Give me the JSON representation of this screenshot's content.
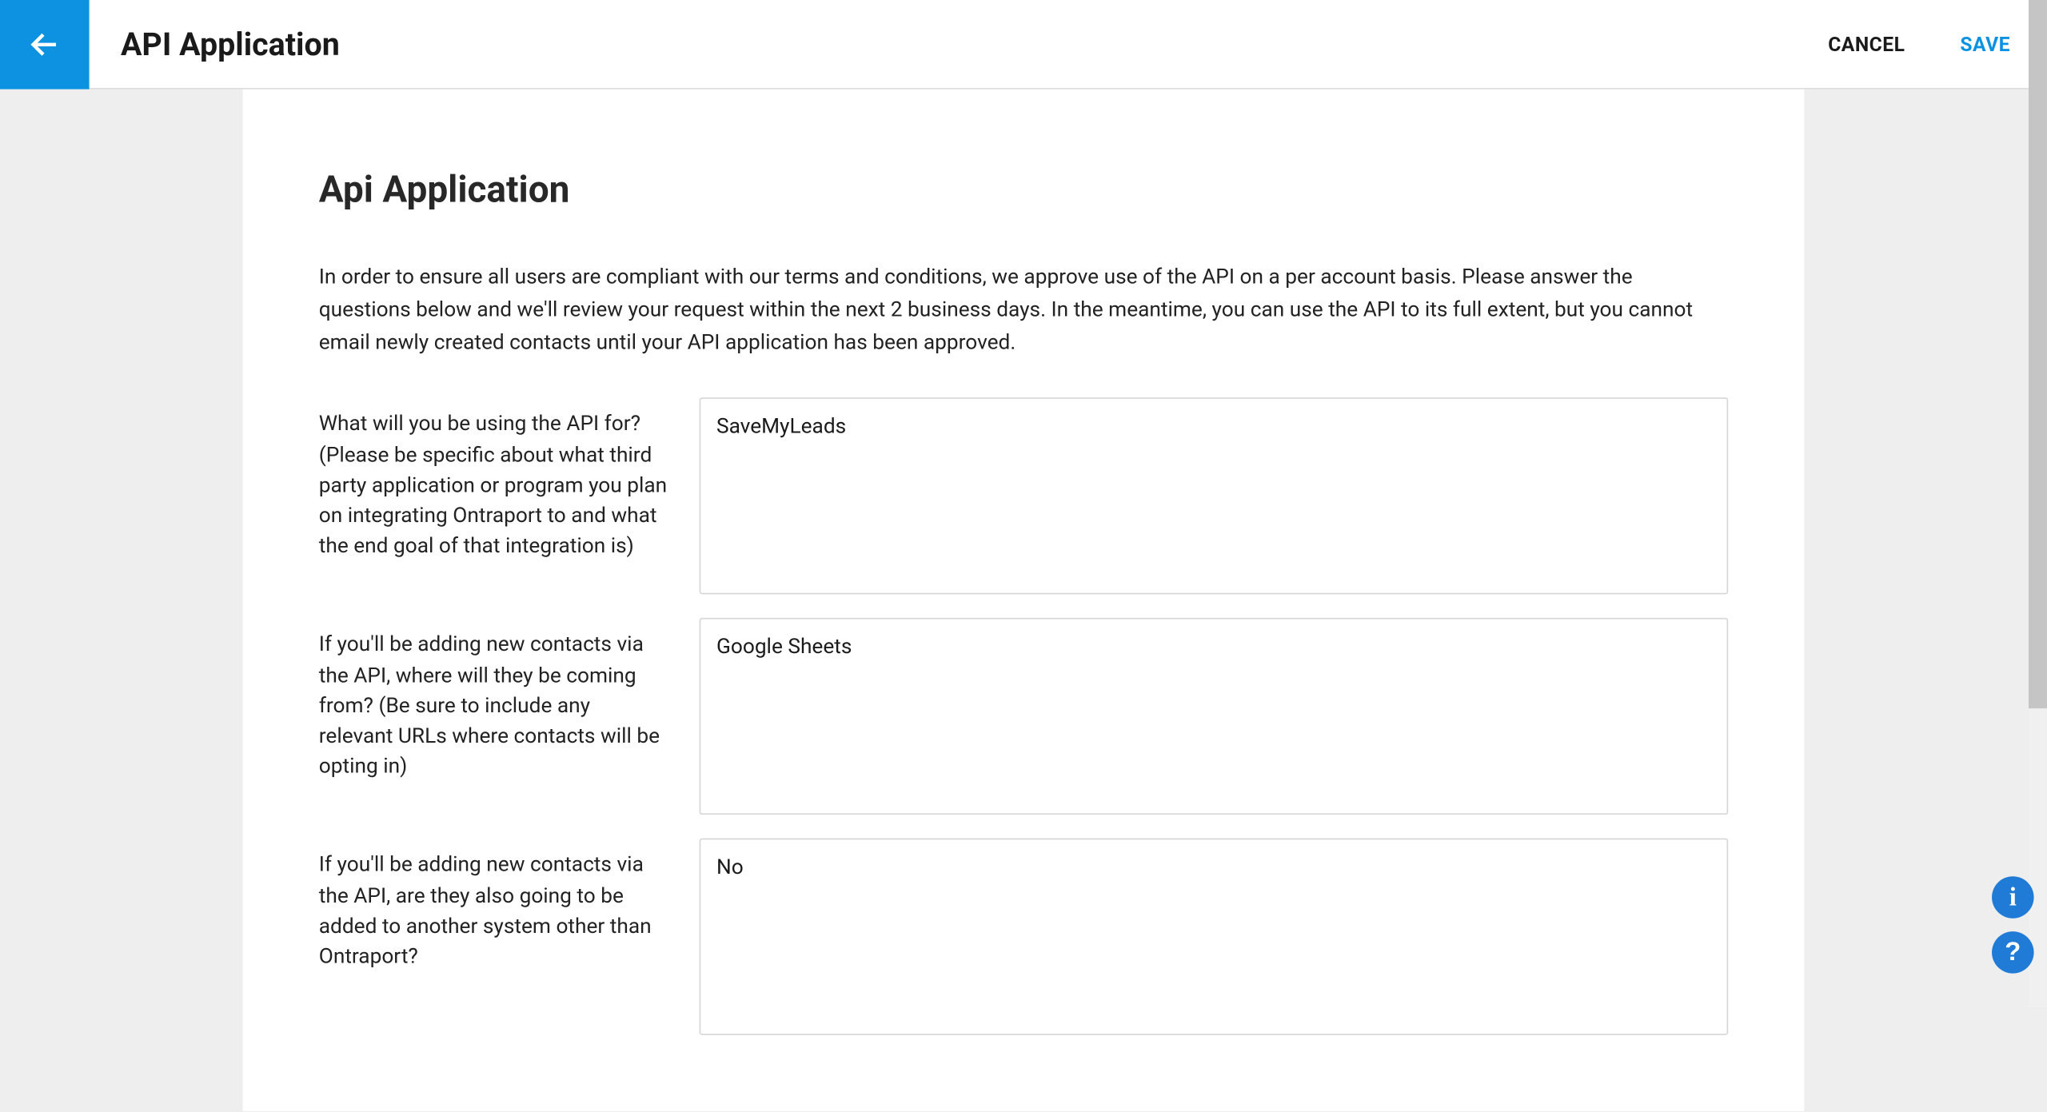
{
  "header": {
    "title": "API Application",
    "cancel": "CANCEL",
    "save": "SAVE"
  },
  "main": {
    "section_title": "Api Application",
    "intro": "In order to ensure all users are compliant with our terms and conditions, we approve use of the API on a per account basis. Please answer the questions below and we'll review your request within the next 2 business days. In the meantime, you can use the API to its full extent, but you cannot email newly created contacts until your API application has been approved.",
    "fields": [
      {
        "label": "What will you be using the API for? (Please be specific about what third party application or program you plan on integrating Ontraport to and what the end goal of that integration is)",
        "value": "SaveMyLeads"
      },
      {
        "label": "If you'll be adding new contacts via the API, where will they be coming from? (Be sure to include any relevant URLs where contacts will be opting in)",
        "value": "Google Sheets"
      },
      {
        "label": "If you'll be adding new contacts via the API, are they also going to be added to another system other than Ontraport?",
        "value": "No"
      }
    ]
  },
  "icons": {
    "info": "i",
    "help": "?"
  }
}
